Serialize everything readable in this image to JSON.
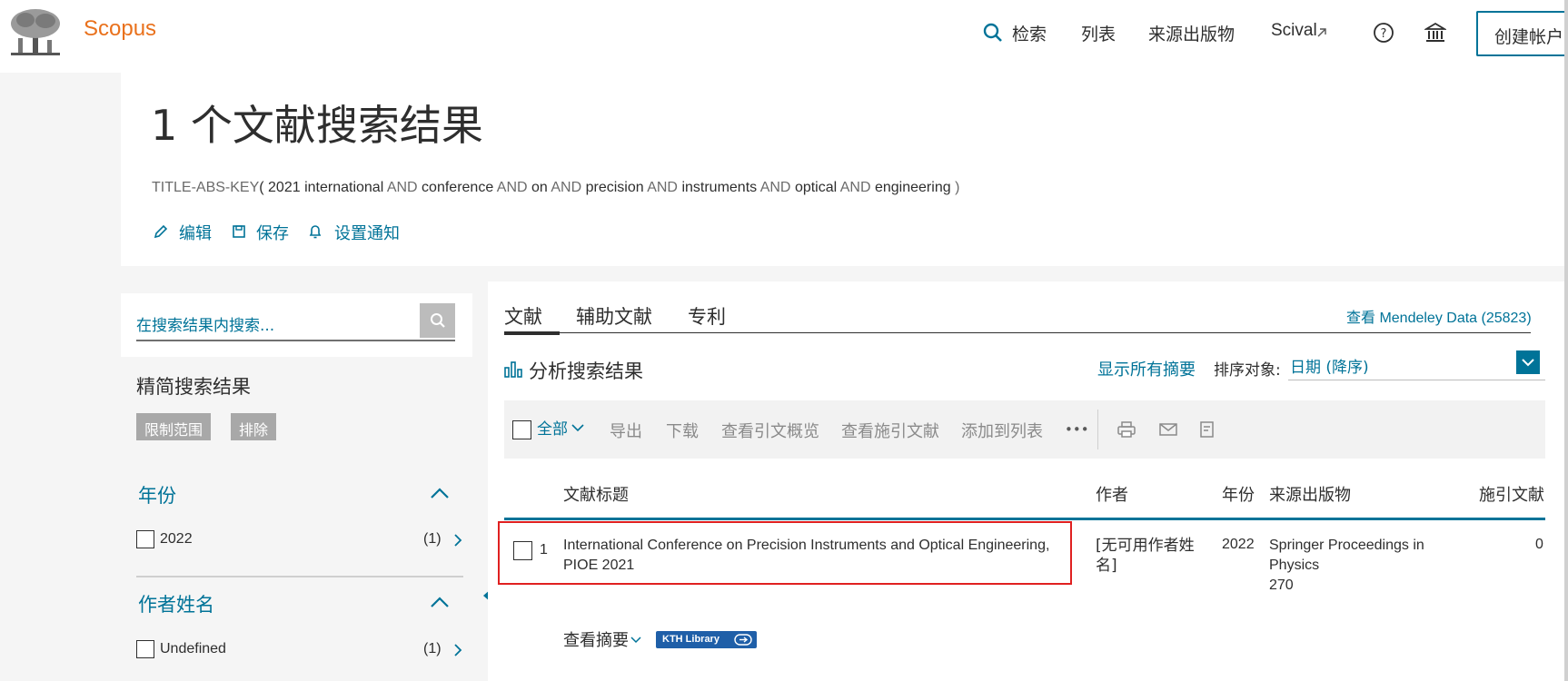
{
  "header": {
    "brand": "Scopus",
    "nav": {
      "search": "检索",
      "lists": "列表",
      "sources": "来源出版物",
      "scival": "Scival",
      "create_account": "创建帐户"
    }
  },
  "title_panel": {
    "title": "1 个文献搜索结果",
    "query": {
      "field": "TITLE-ABS-KEY",
      "open_paren": "(",
      "terms": [
        "2021",
        "international",
        "conference",
        "on",
        "precision",
        "instruments",
        "optical",
        "engineering"
      ],
      "operator": "AND",
      "close_paren": ")"
    },
    "actions": {
      "edit": "编辑",
      "save": "保存",
      "alert": "设置通知"
    }
  },
  "sidebar": {
    "search_placeholder": "在搜索结果内搜索...",
    "refine_title": "精简搜索结果",
    "limit_to": "限制范围",
    "exclude": "排除",
    "facets": [
      {
        "title": "年份",
        "item": "2022",
        "count": "(1)"
      },
      {
        "title": "作者姓名",
        "item": "Undefined",
        "count": "(1)"
      }
    ]
  },
  "main": {
    "tabs": [
      "文献",
      "辅助文献",
      "专利"
    ],
    "mendeley": "查看 Mendeley Data (25823)",
    "analyze": "分析搜索结果",
    "show_all_abstracts": "显示所有摘要",
    "sort_label": "排序对象:",
    "sort_value": "日期 (降序)",
    "toolbar": {
      "select_all": "全部",
      "export": "导出",
      "download": "下载",
      "citation_overview": "查看引文概览",
      "cited_by": "查看施引文献",
      "add_to_list": "添加到列表",
      "more": "•••"
    },
    "table": {
      "headers": {
        "title": "文献标题",
        "authors": "作者",
        "year": "年份",
        "source": "来源出版物",
        "cited_by": "施引文献"
      },
      "rows": [
        {
          "num": "1",
          "title": "International Conference on Precision Instruments and Optical Engineering, PIOE 2021",
          "authors": "[无可用作者姓名]",
          "year": "2022",
          "source": "Springer Proceedings in Physics",
          "volume": "270",
          "cited": "0",
          "view_abstract": "查看摘要",
          "library_button": "KTH Library"
        }
      ]
    }
  },
  "colors": {
    "brand_orange": "#e9711c",
    "link_blue": "#007398",
    "highlight_red": "#e02020"
  }
}
